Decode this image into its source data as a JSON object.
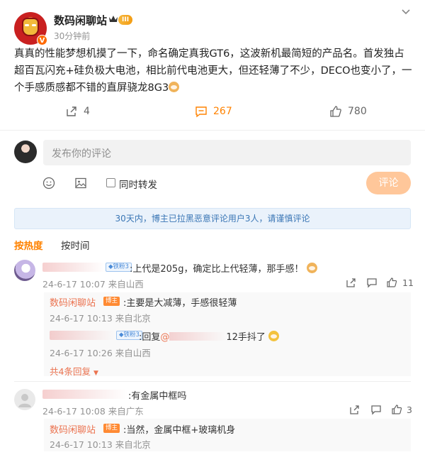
{
  "post": {
    "author": "数码闲聊站",
    "level": "III",
    "verify_mark": "V",
    "time": "30分钟前",
    "text_main": "真真的性能梦想机摸了一下，命名确定真我GT6，这波新机最简短的产品名。首发独占超百瓦闪充+硅负极大电池，相比前代电池更大，但还轻薄了不少，DECO也变小了，一个手感质感都不错的直屏骁龙8G3",
    "repost_count": "4",
    "comment_count": "267",
    "like_count": "780"
  },
  "composer": {
    "placeholder": "发布你的评论",
    "repost_label": "同时转发",
    "submit_label": "评论"
  },
  "notice": "30天内，博主已拉黑恶意评论用户3人，请谨慎评论",
  "tabs": {
    "hot": "按热度",
    "time": "按时间"
  },
  "comments": [
    {
      "fan_badge": "铁粉3",
      "text": ":上代是205g，确定比上代轻薄，那手感！",
      "meta": "24-6-17 10:07 来自山西",
      "likes": "11",
      "replies": [
        {
          "author": "数码闲聊站",
          "badge": "博主",
          "text": ":主要是大减薄，手感很轻薄",
          "meta": "24-6-17 10:13 来自北京"
        },
        {
          "fan_badge": "铁粉3",
          "text_prefix": ":回复",
          "mention": "@",
          "text_suffix": "12手抖了",
          "meta": "24-6-17 10:26 来自山西"
        }
      ],
      "more_replies": "共4条回复"
    },
    {
      "text": ":有金属中框吗",
      "meta": "24-6-17 10:08 来自广东",
      "likes": "3",
      "replies": [
        {
          "author": "数码闲聊站",
          "badge": "博主",
          "text": ":当然，金属中框+玻璃机身",
          "meta": "24-6-17 10:13 来自北京"
        }
      ]
    }
  ]
}
